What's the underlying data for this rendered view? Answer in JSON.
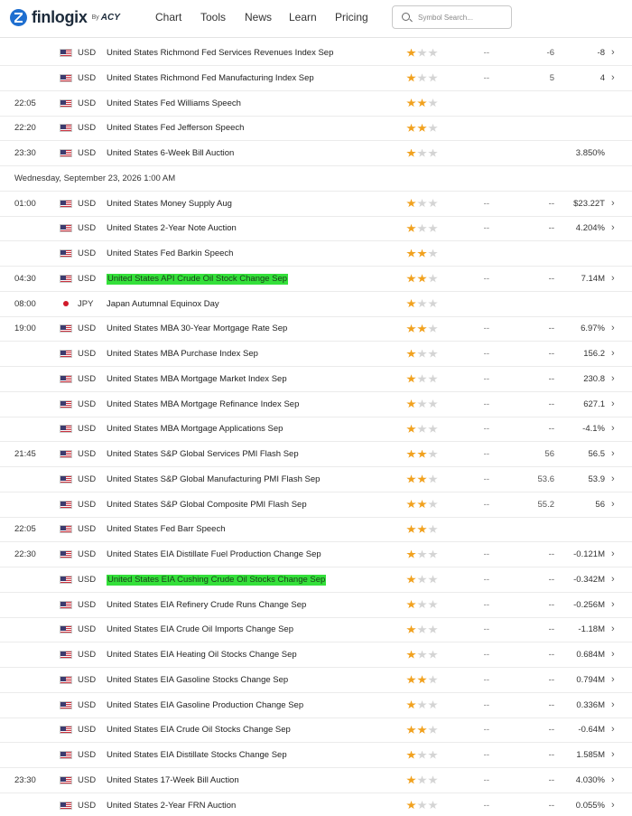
{
  "header": {
    "logo_text": "finlogix",
    "logo_by": "By",
    "logo_partner": "ACY",
    "nav": [
      "Chart",
      "Tools",
      "News",
      "Learn",
      "Pricing"
    ],
    "search_placeholder": "Symbol Search..."
  },
  "colors": {
    "highlight": "#34e03a",
    "star_on": "#f1a11e",
    "star_off": "#d4d4d4",
    "brand": "#1f6fd0"
  },
  "rows": [
    {
      "kind": "event",
      "time": "",
      "flag": "us-flag-icon",
      "currency": "USD",
      "event": "United States Richmond Fed Services Revenues Index Sep",
      "stars": 1,
      "actual": "--",
      "forecast": "-6",
      "previous": "-8",
      "arrow": "›",
      "highlight": false
    },
    {
      "kind": "event",
      "time": "",
      "flag": "us-flag-icon",
      "currency": "USD",
      "event": "United States Richmond Fed Manufacturing Index Sep",
      "stars": 1,
      "actual": "--",
      "forecast": "5",
      "previous": "4",
      "arrow": "›",
      "highlight": false
    },
    {
      "kind": "event",
      "time": "22:05",
      "flag": "us-flag-icon",
      "currency": "USD",
      "event": "United States Fed Williams Speech",
      "stars": 2,
      "actual": "",
      "forecast": "",
      "previous": "",
      "arrow": "",
      "highlight": false
    },
    {
      "kind": "event",
      "time": "22:20",
      "flag": "us-flag-icon",
      "currency": "USD",
      "event": "United States Fed Jefferson Speech",
      "stars": 2,
      "actual": "",
      "forecast": "",
      "previous": "",
      "arrow": "",
      "highlight": false
    },
    {
      "kind": "event",
      "time": "23:30",
      "flag": "us-flag-icon",
      "currency": "USD",
      "event": "United States 6-Week Bill Auction",
      "stars": 1,
      "actual": "",
      "forecast": "",
      "previous": "3.850%",
      "arrow": "",
      "highlight": false
    },
    {
      "kind": "date",
      "label": "Wednesday, September 23, 2026 1:00 AM"
    },
    {
      "kind": "event",
      "time": "01:00",
      "flag": "us-flag-icon",
      "currency": "USD",
      "event": "United States Money Supply Aug",
      "stars": 1,
      "actual": "--",
      "forecast": "--",
      "previous": "$23.22T",
      "arrow": "›",
      "highlight": false
    },
    {
      "kind": "event",
      "time": "",
      "flag": "us-flag-icon",
      "currency": "USD",
      "event": "United States 2-Year Note Auction",
      "stars": 1,
      "actual": "--",
      "forecast": "--",
      "previous": "4.204%",
      "arrow": "›",
      "highlight": false
    },
    {
      "kind": "event",
      "time": "",
      "flag": "us-flag-icon",
      "currency": "USD",
      "event": "United States Fed Barkin Speech",
      "stars": 2,
      "actual": "",
      "forecast": "",
      "previous": "",
      "arrow": "",
      "highlight": false
    },
    {
      "kind": "event",
      "time": "04:30",
      "flag": "us-flag-icon",
      "currency": "USD",
      "event": "United States API Crude Oil Stock Change Sep",
      "stars": 2,
      "actual": "--",
      "forecast": "--",
      "previous": "7.14M",
      "arrow": "›",
      "highlight": true
    },
    {
      "kind": "event",
      "time": "08:00",
      "flag": "jp-flag-icon",
      "currency": "JPY",
      "event": "Japan Autumnal Equinox Day",
      "stars": 1,
      "actual": "",
      "forecast": "",
      "previous": "",
      "arrow": "",
      "highlight": false
    },
    {
      "kind": "event",
      "time": "19:00",
      "flag": "us-flag-icon",
      "currency": "USD",
      "event": "United States MBA 30-Year Mortgage Rate Sep",
      "stars": 2,
      "actual": "--",
      "forecast": "--",
      "previous": "6.97%",
      "arrow": "›",
      "highlight": false
    },
    {
      "kind": "event",
      "time": "",
      "flag": "us-flag-icon",
      "currency": "USD",
      "event": "United States MBA Purchase Index Sep",
      "stars": 1,
      "actual": "--",
      "forecast": "--",
      "previous": "156.2",
      "arrow": "›",
      "highlight": false
    },
    {
      "kind": "event",
      "time": "",
      "flag": "us-flag-icon",
      "currency": "USD",
      "event": "United States MBA Mortgage Market Index Sep",
      "stars": 1,
      "actual": "--",
      "forecast": "--",
      "previous": "230.8",
      "arrow": "›",
      "highlight": false
    },
    {
      "kind": "event",
      "time": "",
      "flag": "us-flag-icon",
      "currency": "USD",
      "event": "United States MBA Mortgage Refinance Index Sep",
      "stars": 1,
      "actual": "--",
      "forecast": "--",
      "previous": "627.1",
      "arrow": "›",
      "highlight": false
    },
    {
      "kind": "event",
      "time": "",
      "flag": "us-flag-icon",
      "currency": "USD",
      "event": "United States MBA Mortgage Applications Sep",
      "stars": 1,
      "actual": "--",
      "forecast": "--",
      "previous": "-4.1%",
      "arrow": "›",
      "highlight": false
    },
    {
      "kind": "event",
      "time": "21:45",
      "flag": "us-flag-icon",
      "currency": "USD",
      "event": "United States S&P Global Services PMI Flash Sep",
      "stars": 2,
      "actual": "--",
      "forecast": "56",
      "previous": "56.5",
      "arrow": "›",
      "highlight": false
    },
    {
      "kind": "event",
      "time": "",
      "flag": "us-flag-icon",
      "currency": "USD",
      "event": "United States S&P Global Manufacturing PMI Flash Sep",
      "stars": 2,
      "actual": "--",
      "forecast": "53.6",
      "previous": "53.9",
      "arrow": "›",
      "highlight": false
    },
    {
      "kind": "event",
      "time": "",
      "flag": "us-flag-icon",
      "currency": "USD",
      "event": "United States S&P Global Composite PMI Flash Sep",
      "stars": 2,
      "actual": "--",
      "forecast": "55.2",
      "previous": "56",
      "arrow": "›",
      "highlight": false
    },
    {
      "kind": "event",
      "time": "22:05",
      "flag": "us-flag-icon",
      "currency": "USD",
      "event": "United States Fed Barr Speech",
      "stars": 2,
      "actual": "",
      "forecast": "",
      "previous": "",
      "arrow": "",
      "highlight": false
    },
    {
      "kind": "event",
      "time": "22:30",
      "flag": "us-flag-icon",
      "currency": "USD",
      "event": "United States EIA Distillate Fuel Production Change Sep",
      "stars": 1,
      "actual": "--",
      "forecast": "--",
      "previous": "-0.121M",
      "arrow": "›",
      "highlight": false
    },
    {
      "kind": "event",
      "time": "",
      "flag": "us-flag-icon",
      "currency": "USD",
      "event": "United States EIA Cushing Crude Oil Stocks Change Sep",
      "stars": 1,
      "actual": "--",
      "forecast": "--",
      "previous": "-0.342M",
      "arrow": "›",
      "highlight": true
    },
    {
      "kind": "event",
      "time": "",
      "flag": "us-flag-icon",
      "currency": "USD",
      "event": "United States EIA Refinery Crude Runs Change Sep",
      "stars": 1,
      "actual": "--",
      "forecast": "--",
      "previous": "-0.256M",
      "arrow": "›",
      "highlight": false
    },
    {
      "kind": "event",
      "time": "",
      "flag": "us-flag-icon",
      "currency": "USD",
      "event": "United States EIA Crude Oil Imports Change Sep",
      "stars": 1,
      "actual": "--",
      "forecast": "--",
      "previous": "-1.18M",
      "arrow": "›",
      "highlight": false
    },
    {
      "kind": "event",
      "time": "",
      "flag": "us-flag-icon",
      "currency": "USD",
      "event": "United States EIA Heating Oil Stocks Change Sep",
      "stars": 1,
      "actual": "--",
      "forecast": "--",
      "previous": "0.684M",
      "arrow": "›",
      "highlight": false
    },
    {
      "kind": "event",
      "time": "",
      "flag": "us-flag-icon",
      "currency": "USD",
      "event": "United States EIA Gasoline Stocks Change Sep",
      "stars": 2,
      "actual": "--",
      "forecast": "--",
      "previous": "0.794M",
      "arrow": "›",
      "highlight": false
    },
    {
      "kind": "event",
      "time": "",
      "flag": "us-flag-icon",
      "currency": "USD",
      "event": "United States EIA Gasoline Production Change Sep",
      "stars": 1,
      "actual": "--",
      "forecast": "--",
      "previous": "0.336M",
      "arrow": "›",
      "highlight": false
    },
    {
      "kind": "event",
      "time": "",
      "flag": "us-flag-icon",
      "currency": "USD",
      "event": "United States EIA Crude Oil Stocks Change Sep",
      "stars": 2,
      "actual": "--",
      "forecast": "--",
      "previous": "-0.64M",
      "arrow": "›",
      "highlight": false
    },
    {
      "kind": "event",
      "time": "",
      "flag": "us-flag-icon",
      "currency": "USD",
      "event": "United States EIA Distillate Stocks Change Sep",
      "stars": 1,
      "actual": "--",
      "forecast": "--",
      "previous": "1.585M",
      "arrow": "›",
      "highlight": false
    },
    {
      "kind": "event",
      "time": "23:30",
      "flag": "us-flag-icon",
      "currency": "USD",
      "event": "United States 17-Week Bill Auction",
      "stars": 1,
      "actual": "--",
      "forecast": "--",
      "previous": "4.030%",
      "arrow": "›",
      "highlight": false
    },
    {
      "kind": "event",
      "time": "",
      "flag": "us-flag-icon",
      "currency": "USD",
      "event": "United States 2-Year FRN Auction",
      "stars": 1,
      "actual": "--",
      "forecast": "--",
      "previous": "0.055%",
      "arrow": "›",
      "highlight": false
    }
  ]
}
